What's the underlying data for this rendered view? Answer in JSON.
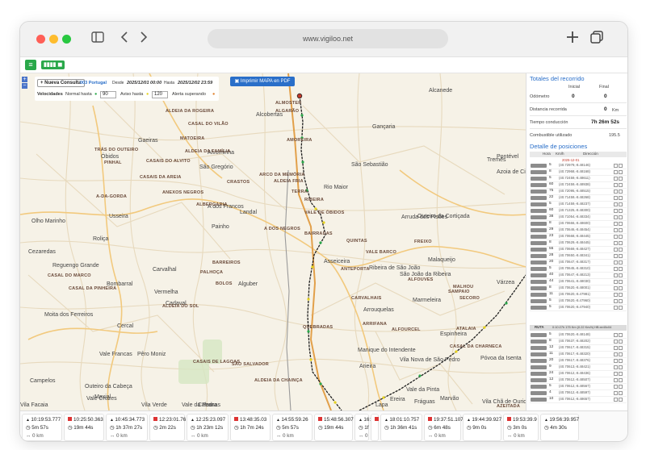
{
  "browser": {
    "url": "www.vigiloo.net",
    "icons": {
      "sidebar": "sidebar-icon",
      "back": "chevron-left-icon",
      "forward": "chevron-right-icon",
      "new_tab": "plus-icon",
      "tabs": "tabs-icon"
    }
  },
  "app": {
    "menu_icon": "menu-icon",
    "vehicle_badge": "▮▮▮▮ ◼"
  },
  "filters": {
    "new_query_label": "Nueva Consulta",
    "vehicle": "003 Portugal",
    "from_label": "Desde",
    "from_value": "2025/12/01 00:00",
    "to_label": "Hasta",
    "to_value": "2025/12/02 23:59",
    "speeds_label": "Velocidades",
    "normal_label": "Normal hasta",
    "normal_value": "90",
    "warning_label": "Aviso hasta",
    "warning_value": "120",
    "alert_label": "Alerta superando"
  },
  "map": {
    "print_label": "Imprimir MAPA en PDF",
    "zoom_in": "+",
    "zoom_out": "−",
    "towns": [
      "Óbidos",
      "São Gregório",
      "Rio Maior",
      "Landal",
      "A dos Francos",
      "Painho",
      "Cadaval",
      "Alguber",
      "Bombarral",
      "Alcobertas",
      "Alcanede",
      "Tremês",
      "Arruda dos Pisões",
      "Asseiceira",
      "Ribeira de São João",
      "São João da Ribeira",
      "Malaqueijo",
      "Arrouquelas",
      "Marmeleira",
      "Manique do Intendente",
      "Vila Nova de São Pedro",
      "Azoia de Cima",
      "Várzea",
      "Póvoa da Isenta",
      "Vila Chã de Ourique",
      "Vale da Pinta",
      "Vale Francas",
      "Pêro Moniz",
      "Campelos",
      "Outeiro da Cabeça",
      "Vale Cruzes",
      "Maxial",
      "Moita dos Ferreiros",
      "Cercal",
      "Olho Marinho",
      "Usseira",
      "Roliça",
      "Cezaredas",
      "Reguengo Grande",
      "Gaeiras",
      "Alvorninha",
      "Carvalhal",
      "Vermelha",
      "Outeiro da Cortiçada",
      "Gançaria",
      "Vila Verde",
      "Cabanas",
      "Lapa",
      "Ereira",
      "Pontével",
      "Vale da Pedra",
      "São Sebastião",
      "Vila Facaia",
      "Espinheira",
      "Arieira",
      "Fráguas",
      "Marvão"
    ],
    "places": [
      "ALGARÃO",
      "ALMOSTER",
      "ALDEIA DA ROGEIRA",
      "MATOEIRA",
      "CASAL DO VILÃO",
      "AMOREIRA",
      "TRÁS DO OUTEIRO",
      "PINHAL",
      "ALDEIA DA FAMÍLIA",
      "CASAIS DO ALVITO",
      "ARCO DA MEMÓRIA",
      "ALDEIA FRIA",
      "CRASTOS",
      "ANEXOS NEGROS",
      "A-DA-GORDA",
      "CASAIS DA AREIA",
      "TERRA",
      "RIBEIRA",
      "ALBERGARIA",
      "A DOS NEGROS",
      "BAIRRADAS",
      "VALE DE ÓBIDOS",
      "PALHOÇA",
      "BARREIROS",
      "BOLOS",
      "QUINTAS",
      "VALE BARCO",
      "FREIXO",
      "ANTEPORTA",
      "CARVALHAIS",
      "CASAL DO MARCO",
      "ALFOUVES",
      "SAMPAIO",
      "MALHOU",
      "SECORO",
      "CASAL DA CHARNECA",
      "ARRIFANA",
      "QUEBRADAS",
      "ALFOURCEL",
      "ATALAIA",
      "AZEITADA",
      "CASAL DA PINHEIRA",
      "ALDEIA DO SOL",
      "SÃO SALVADOR",
      "ALDEIA DA CHAINÇA",
      "CASAIS DE LAGOAS"
    ]
  },
  "summary": {
    "title": "Totales del recorrido",
    "initial_label": "Inicial",
    "final_label": "Final",
    "odometer_label": "Odómetro",
    "odometer_initial": "0",
    "odometer_final": "0",
    "distance_label": "Distancia recorrida",
    "distance_value": "0",
    "distance_unit": "Km",
    "drive_time_label": "Tiempo conducción",
    "drive_time_value": "7h 26m 52s",
    "fuel_label": "Combustible utilizado",
    "fuel_value": "195.5"
  },
  "positions": {
    "title": "Detalle de posiciones",
    "col_time": "Hora",
    "col_speed": "Km/h",
    "col_address": "Dirección",
    "date_row": "2025-12-01",
    "rows": [
      {
        "speed": "5",
        "coords": "(40.72979,-8.48146)"
      },
      {
        "speed": "8",
        "coords": "(40.72968,-8.48168)"
      },
      {
        "speed": "5",
        "coords": "(40.72459,-8.48611)"
      },
      {
        "speed": "60",
        "coords": "(40.72459,-8.48938)"
      },
      {
        "speed": "75",
        "coords": "(40.72095,-8.48515)"
      },
      {
        "speed": "22",
        "coords": "(40.71459,-8.48268)"
      },
      {
        "speed": "5",
        "coords": "(40.71459,-8.48237)"
      },
      {
        "speed": "60",
        "coords": "(40.71325,-8.48300)"
      },
      {
        "speed": "38",
        "coords": "(40.71054,-8.48334)"
      },
      {
        "speed": "8",
        "coords": "(40.70666,-8.48600)"
      },
      {
        "speed": "29",
        "coords": "(40.70646,-8.48454)"
      },
      {
        "speed": "23",
        "coords": "(40.70668,-8.48445)"
      },
      {
        "speed": "8",
        "coords": "(40.70629,-8.48445)"
      },
      {
        "speed": "55",
        "coords": "(40.70669,-8.48427)"
      },
      {
        "speed": "28",
        "coords": "(40.70650,-8.48341)"
      },
      {
        "speed": "20",
        "coords": "(40.70647,-8.48317)"
      },
      {
        "speed": "5",
        "coords": "(40.70645,-8.48310)"
      },
      {
        "speed": "40",
        "coords": "(40.70647,-8.48213)"
      },
      {
        "speed": "44",
        "coords": "(40.70641,-8.48030)"
      },
      {
        "speed": "8",
        "coords": "(40.70620,-8.48001)"
      },
      {
        "speed": "11",
        "coords": "(40.70620,-8.47981)"
      },
      {
        "speed": "5",
        "coords": "(40.70620,-8.47960)"
      },
      {
        "speed": "5",
        "coords": "(40.70620,-8.47940)"
      }
    ],
    "route_row": "RUTA",
    "route_text": "0:10:27h 175 Km (0.22 Km/h) HB:xe40c04",
    "rows2": [
      {
        "speed": "5",
        "coords": "(40.70620,-8.48148)"
      },
      {
        "speed": "8",
        "coords": "(40.70637,-8.48202)"
      },
      {
        "speed": "12",
        "coords": "(40.70617,-8.48315)"
      },
      {
        "speed": "11",
        "coords": "(40.70617,-8.48320)"
      },
      {
        "speed": "20",
        "coords": "(40.70617,-8.48376)"
      },
      {
        "speed": "9",
        "coords": "(40.70613,-8.48421)"
      },
      {
        "speed": "24",
        "coords": "(40.70612,-8.48436)"
      },
      {
        "speed": "12",
        "coords": "(40.70612,-8.48507)"
      },
      {
        "speed": "5",
        "coords": "(40.70612,-8.48567)"
      },
      {
        "speed": "4",
        "coords": "(40.70612,-8.48597)"
      },
      {
        "speed": "10",
        "coords": "(40.70612,-8.48657)"
      }
    ]
  },
  "events": [
    {
      "time": "10:19:53.777",
      "duration": "5m 57s",
      "distance": "0 km"
    },
    {
      "time": "10:25:50.363",
      "duration": "19m 44s",
      "distance": ""
    },
    {
      "time": "10:45:34.773",
      "duration": "1h 37m 27s",
      "distance": "0 km"
    },
    {
      "time": "12:23:01.76",
      "duration": "2m 22s",
      "distance": ""
    },
    {
      "time": "12:25:23.097",
      "duration": "1h 23m 12s",
      "distance": "0 km"
    },
    {
      "time": "13:48:35.03",
      "duration": "1h 7m 24s",
      "distance": ""
    },
    {
      "time": "14:55:59.26",
      "duration": "5m 57s",
      "distance": "0 km"
    },
    {
      "time": "15:48:56.307",
      "duration": "19m 44s",
      "distance": ""
    },
    {
      "time": "16:",
      "duration": "1f",
      "distance": "0"
    },
    {
      "time": "7",
      "duration": "",
      "distance": ""
    },
    {
      "time": "18:01:10.757",
      "duration": "1h 36m 41s",
      "distance": ""
    },
    {
      "time": "19:37:51.107",
      "duration": "6m 48s",
      "distance": "0 km"
    },
    {
      "time": "19:44:39.927",
      "duration": "9m 0s",
      "distance": ""
    },
    {
      "time": "19:53:39.9",
      "duration": "3m 0s",
      "distance": "0 km"
    },
    {
      "time": "19:56:39.957",
      "duration": "4m 30s",
      "distance": ""
    }
  ]
}
